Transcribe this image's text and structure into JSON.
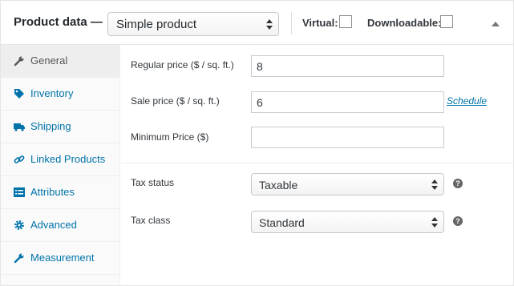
{
  "header": {
    "title": "Product data —",
    "product_type": "Simple product",
    "virtual_label": "Virtual:",
    "downloadable_label": "Downloadable:"
  },
  "tabs": [
    {
      "label": "General",
      "icon": "wrench-icon",
      "active": true
    },
    {
      "label": "Inventory",
      "icon": "tag-icon"
    },
    {
      "label": "Shipping",
      "icon": "truck-icon"
    },
    {
      "label": "Linked Products",
      "icon": "link-icon"
    },
    {
      "label": "Attributes",
      "icon": "list-icon"
    },
    {
      "label": "Advanced",
      "icon": "gear-icon"
    },
    {
      "label": "Measurement",
      "icon": "wrench-icon"
    }
  ],
  "fields": {
    "regular_price": {
      "label": "Regular price ($ / sq. ft.)",
      "value": "8"
    },
    "sale_price": {
      "label": "Sale price ($ / sq. ft.)",
      "value": "6",
      "schedule_link": "Schedule"
    },
    "minimum_price": {
      "label": "Minimum Price ($)",
      "value": ""
    },
    "tax_status": {
      "label": "Tax status",
      "value": "Taxable"
    },
    "tax_class": {
      "label": "Tax class",
      "value": "Standard"
    }
  },
  "help_glyph": "?"
}
